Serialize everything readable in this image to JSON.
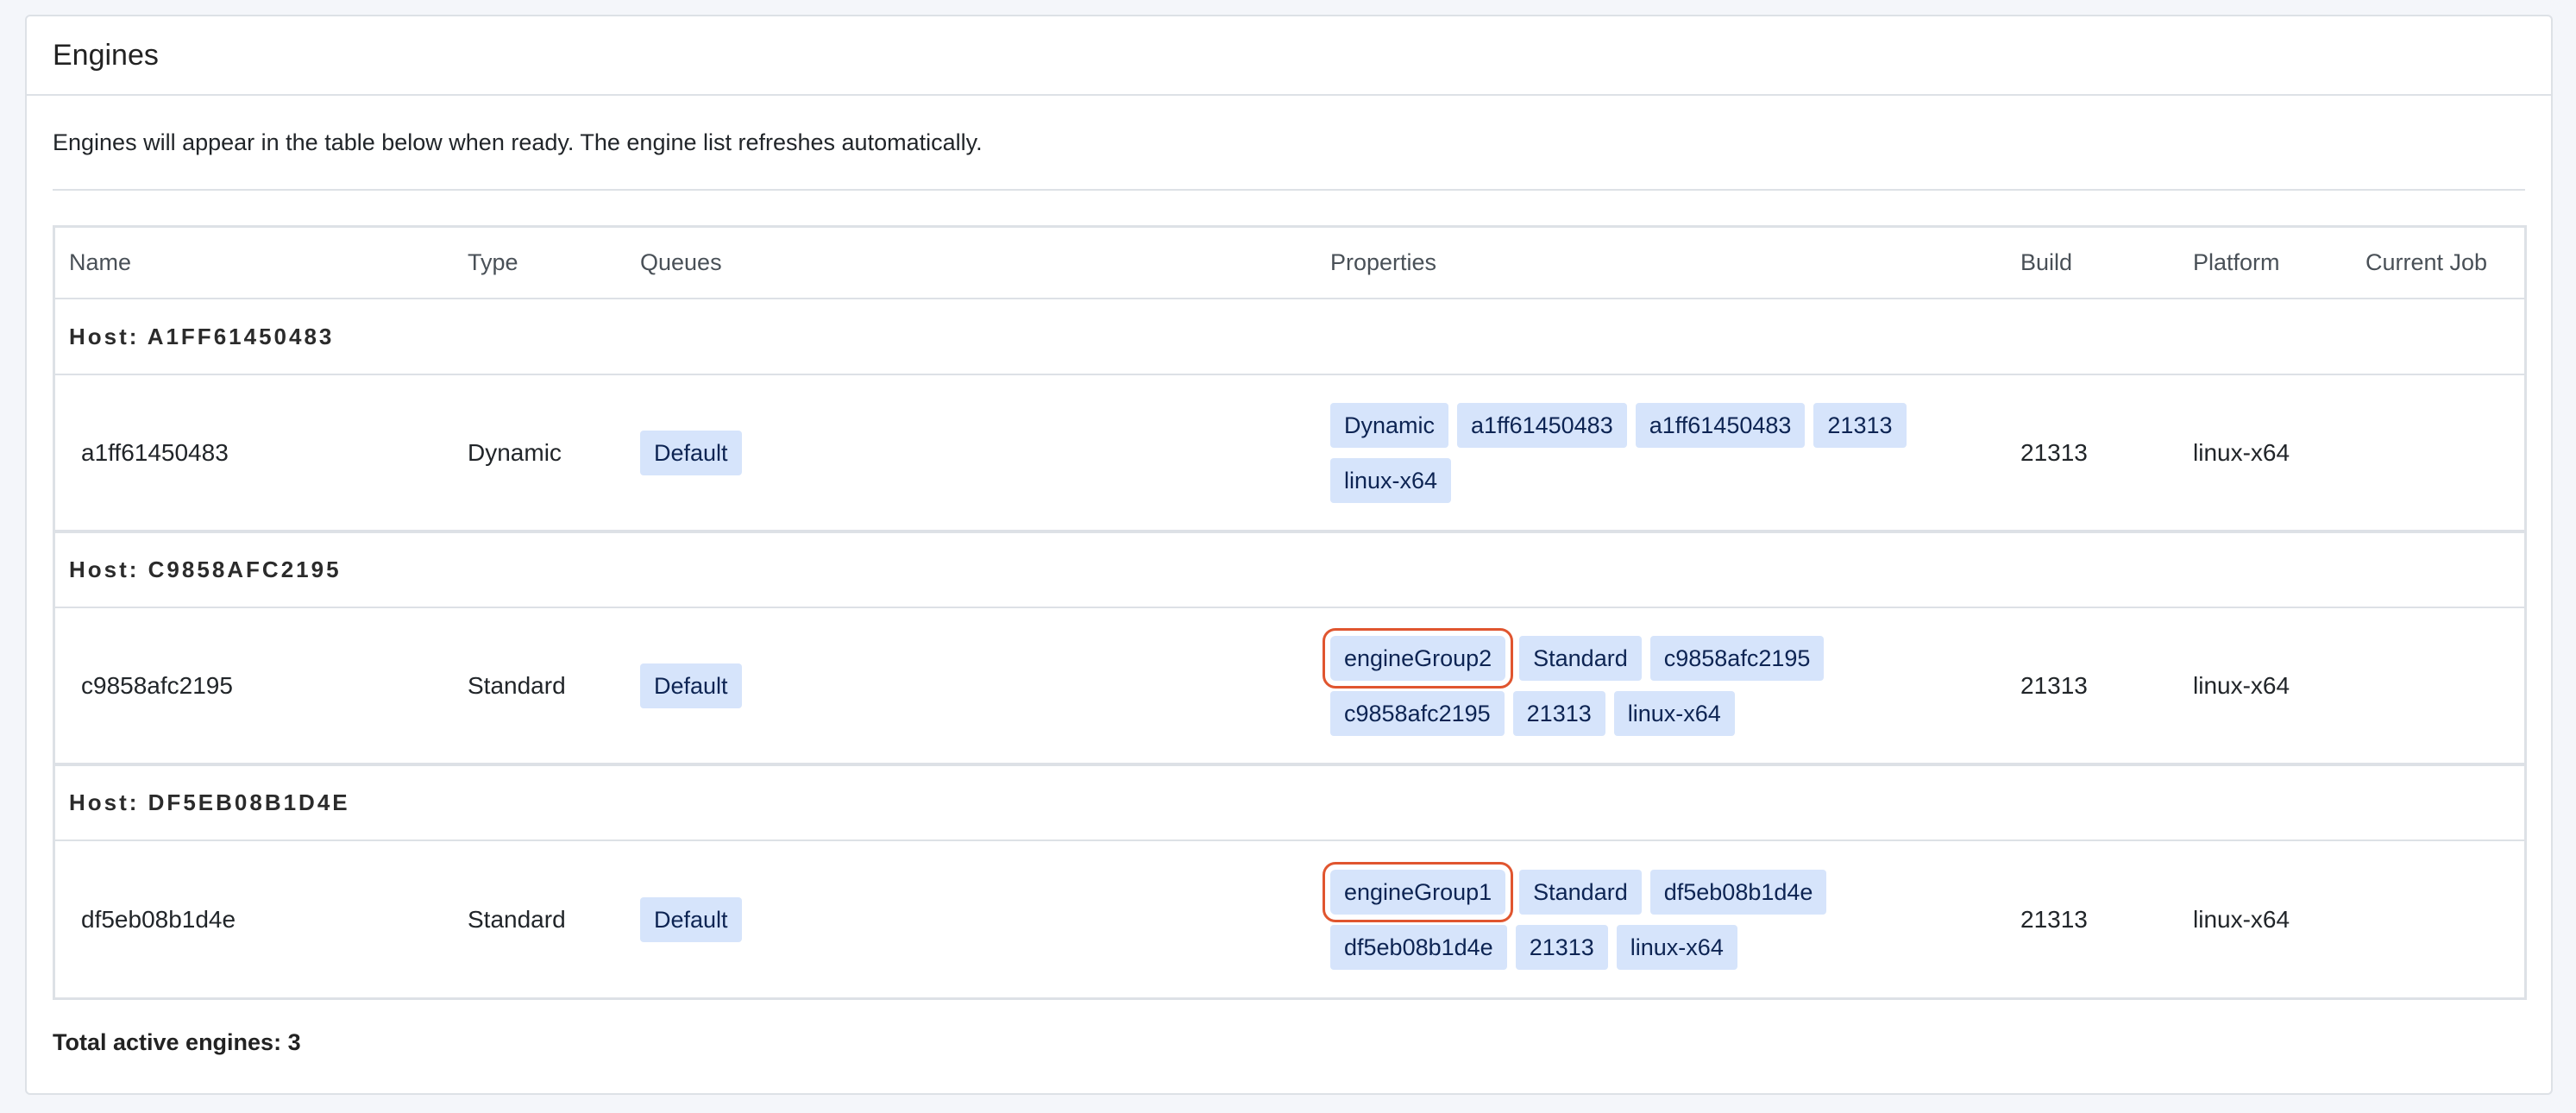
{
  "card": {
    "title": "Engines",
    "info": "Engines will appear in the table below when ready. The engine list refreshes automatically."
  },
  "table": {
    "columns": [
      "Name",
      "Type",
      "Queues",
      "Properties",
      "Build",
      "Platform",
      "Current Job"
    ],
    "groups": [
      {
        "host": "Host: A1FF61450483",
        "name": "a1ff61450483",
        "type": "Dynamic",
        "queue": "Default",
        "properties": [
          "Dynamic",
          "a1ff61450483",
          "a1ff61450483",
          "21313",
          "linux-x64"
        ],
        "build": "21313",
        "platform": "linux-x64",
        "current_job": ""
      },
      {
        "host": "Host: C9858AFC2195",
        "name": "c9858afc2195",
        "type": "Standard",
        "queue": "Default",
        "properties": [
          "engineGroup2",
          "Standard",
          "c9858afc2195",
          "c9858afc2195",
          "21313",
          "linux-x64"
        ],
        "build": "21313",
        "platform": "linux-x64",
        "current_job": ""
      },
      {
        "host": "Host: DF5EB08B1D4E",
        "name": "df5eb08b1d4e",
        "type": "Standard",
        "queue": "Default",
        "properties": [
          "engineGroup1",
          "Standard",
          "df5eb08b1d4e",
          "df5eb08b1d4e",
          "21313",
          "linux-x64"
        ],
        "build": "21313",
        "platform": "linux-x64",
        "current_job": ""
      }
    ]
  },
  "footer": {
    "total": "Total active engines: 3"
  },
  "colors": {
    "badge_bg": "#d6e4fb",
    "highlight": "#e0552f"
  }
}
